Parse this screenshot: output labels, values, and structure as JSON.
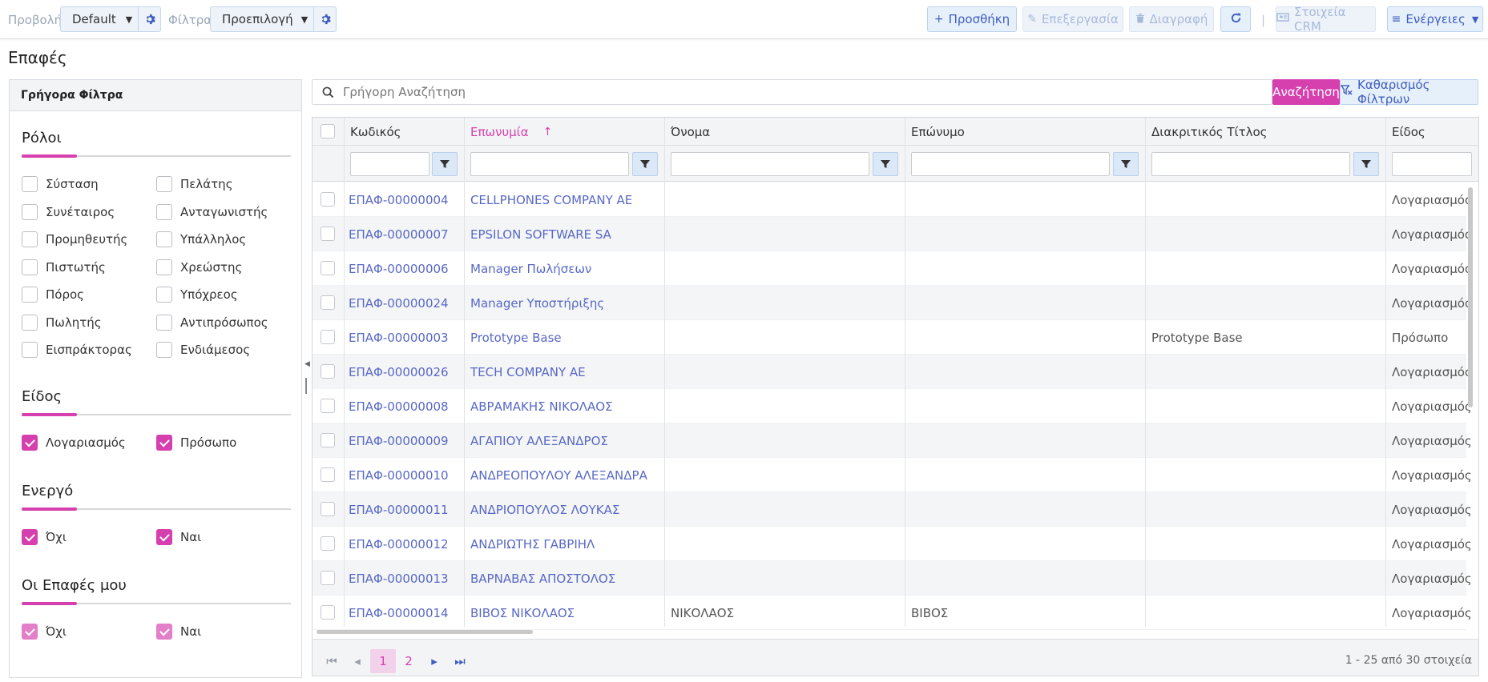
{
  "toolbar": {
    "view_label": "Προβολή",
    "view_value": "Default",
    "filters_label": "Φίλτρα",
    "filters_value": "Προεπιλογή",
    "add_label": "Προσθήκη",
    "edit_label": "Επεξεργασία",
    "delete_label": "Διαγραφή",
    "crm_label": "Στοιχεία CRM",
    "actions_label": "Ενέργειες",
    "accent_color": "#d63fae",
    "link_color": "#3f5dbf"
  },
  "page": {
    "title": "Επαφές"
  },
  "quick_filters": {
    "header": "Γρήγορα Φίλτρα",
    "roles": {
      "title": "Ρόλοι",
      "items": [
        {
          "label": "Σύσταση",
          "checked": false
        },
        {
          "label": "Πελάτης",
          "checked": false
        },
        {
          "label": "Συνέταιρος",
          "checked": false
        },
        {
          "label": "Ανταγωνιστής",
          "checked": false
        },
        {
          "label": "Προμηθευτής",
          "checked": false
        },
        {
          "label": "Υπάλληλος",
          "checked": false
        },
        {
          "label": "Πιστωτής",
          "checked": false
        },
        {
          "label": "Χρεώστης",
          "checked": false
        },
        {
          "label": "Πόρος",
          "checked": false
        },
        {
          "label": "Υπόχρεος",
          "checked": false
        },
        {
          "label": "Πωλητής",
          "checked": false
        },
        {
          "label": "Αντιπρόσωπος",
          "checked": false
        },
        {
          "label": "Εισπράκτορας",
          "checked": false
        },
        {
          "label": "Ενδιάμεσος",
          "checked": false
        }
      ]
    },
    "kind": {
      "title": "Είδος",
      "items": [
        {
          "label": "Λογαριασμός",
          "checked": true
        },
        {
          "label": "Πρόσωπο",
          "checked": true
        }
      ]
    },
    "active": {
      "title": "Ενεργό",
      "items": [
        {
          "label": "Όχι",
          "checked": true
        },
        {
          "label": "Ναι",
          "checked": true
        }
      ]
    },
    "mine": {
      "title": "Οι Επαφές μου",
      "items": [
        {
          "label": "Όχι",
          "checked": true
        },
        {
          "label": "Ναι",
          "checked": true
        }
      ]
    }
  },
  "search": {
    "placeholder": "Γρήγορη Αναζήτηση",
    "search_button": "Αναζήτηση",
    "clear_button": "Καθαρισμός Φίλτρων"
  },
  "grid": {
    "columns": [
      "Κωδικός",
      "Επωνυμία",
      "Όνομα",
      "Επώνυμο",
      "Διακριτικός Τίτλος",
      "Είδος"
    ],
    "sort_indicator": "↑",
    "rows": [
      [
        "ΕΠΑΦ-00000004",
        "CELLPHONES COMPANY AE",
        "",
        "",
        "",
        "Λογαριασμός"
      ],
      [
        "ΕΠΑΦ-00000007",
        "EPSILON SOFTWARE SA",
        "",
        "",
        "",
        "Λογαριασμός"
      ],
      [
        "ΕΠΑΦ-00000006",
        "Manager Πωλήσεων",
        "",
        "",
        "",
        "Λογαριασμός"
      ],
      [
        "ΕΠΑΦ-00000024",
        "Manager Υποστήριξης",
        "",
        "",
        "",
        "Λογαριασμός"
      ],
      [
        "ΕΠΑΦ-00000003",
        "Prototype Base",
        "",
        "",
        "Prototype Base",
        "Πρόσωπο"
      ],
      [
        "ΕΠΑΦ-00000026",
        "TECH COMPANY AE",
        "",
        "",
        "",
        "Λογαριασμός"
      ],
      [
        "ΕΠΑΦ-00000008",
        "ΑΒΡΑΜΑΚΗΣ ΝΙΚΟΛΑΟΣ",
        "",
        "",
        "",
        "Λογαριασμός"
      ],
      [
        "ΕΠΑΦ-00000009",
        "ΑΓΑΠΙΟΥ ΑΛΕΞΑΝΔΡΟΣ",
        "",
        "",
        "",
        "Λογαριασμός"
      ],
      [
        "ΕΠΑΦ-00000010",
        "ΑΝΔΡΕΟΠΟΥΛΟΥ ΑΛΕΞΑΝΔΡΑ",
        "",
        "",
        "",
        "Λογαριασμός"
      ],
      [
        "ΕΠΑΦ-00000011",
        "ΑΝΔΡΙΟΠΟΥΛΟΣ ΛΟΥΚΑΣ",
        "",
        "",
        "",
        "Λογαριασμός"
      ],
      [
        "ΕΠΑΦ-00000012",
        "ΑΝΔΡΙΩΤΗΣ ΓΑΒΡΙΗΛ",
        "",
        "",
        "",
        "Λογαριασμός"
      ],
      [
        "ΕΠΑΦ-00000013",
        "ΒΑΡΝΑΒΑΣ ΑΠΟΣΤΟΛΟΣ",
        "",
        "",
        "",
        "Λογαριασμός"
      ],
      [
        "ΕΠΑΦ-00000014",
        "ΒΙΒΟΣ ΝΙΚΟΛΑΟΣ",
        "ΝΙΚΟΛΑΟΣ",
        "ΒΙΒΟΣ",
        "",
        "Λογαριασμός"
      ]
    ]
  },
  "pager": {
    "pages": [
      "1",
      "2"
    ],
    "current": "1",
    "info": "1 - 25 από 30 στοιχεία"
  }
}
